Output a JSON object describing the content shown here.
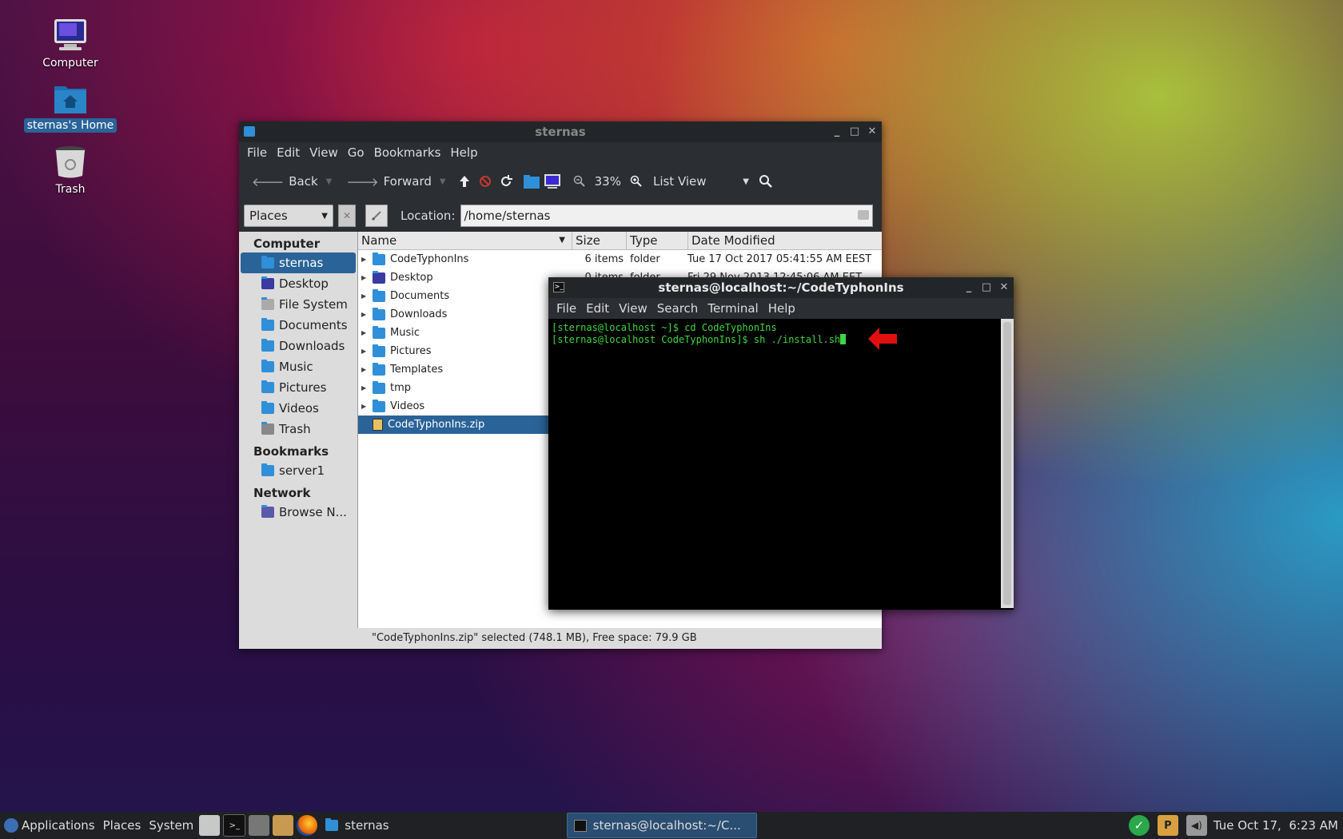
{
  "desktop": {
    "icons": [
      {
        "label": "Computer"
      },
      {
        "label": "sternas's Home"
      },
      {
        "label": "Trash"
      }
    ]
  },
  "file_manager": {
    "title": "sternas",
    "menu": [
      "File",
      "Edit",
      "View",
      "Go",
      "Bookmarks",
      "Help"
    ],
    "toolbar": {
      "back": "Back",
      "forward": "Forward",
      "zoom": "33%",
      "view_mode": "List View"
    },
    "places_select": "Places",
    "location_label": "Location:",
    "location_value": "/home/sternas",
    "sidebar": {
      "computer_heading": "Computer",
      "computer_items": [
        "sternas",
        "Desktop",
        "File System",
        "Documents",
        "Downloads",
        "Music",
        "Pictures",
        "Videos",
        "Trash"
      ],
      "bookmarks_heading": "Bookmarks",
      "bookmark_items": [
        "server1"
      ],
      "network_heading": "Network",
      "network_items": [
        "Browse N..."
      ]
    },
    "columns": [
      "Name",
      "Size",
      "Type",
      "Date Modified"
    ],
    "rows": [
      {
        "name": "CodeTyphonIns",
        "size": "6 items",
        "type": "folder",
        "date": "Tue 17 Oct 2017 05:41:55 AM EEST"
      },
      {
        "name": "Desktop",
        "size": "0 items",
        "type": "folder",
        "date": "Fri 29 Nov 2013 12:45:06 AM EET"
      },
      {
        "name": "Documents"
      },
      {
        "name": "Downloads"
      },
      {
        "name": "Music"
      },
      {
        "name": "Pictures"
      },
      {
        "name": "Templates"
      },
      {
        "name": "tmp"
      },
      {
        "name": "Videos"
      },
      {
        "name": "CodeTyphonIns.zip"
      }
    ],
    "status": "\"CodeTyphonIns.zip\" selected (748.1 MB), Free space: 79.9 GB"
  },
  "terminal": {
    "title": "sternas@localhost:~/CodeTyphonIns",
    "menu": [
      "File",
      "Edit",
      "View",
      "Search",
      "Terminal",
      "Help"
    ],
    "lines": [
      "[sternas@localhost ~]$ cd CodeTyphonIns",
      "[sternas@localhost CodeTyphonIns]$ sh ./install.sh"
    ]
  },
  "taskbar": {
    "applications": "Applications",
    "places": "Places",
    "system": "System",
    "tasks": [
      "sternas",
      "sternas@localhost:~/C..."
    ],
    "clock": "Tue Oct 17,  6:23 AM"
  },
  "colors": {
    "accent": "#2a6398",
    "terminal_text": "#3fd63f",
    "folder": "#2f8fd8",
    "arrow": "#e01010"
  }
}
